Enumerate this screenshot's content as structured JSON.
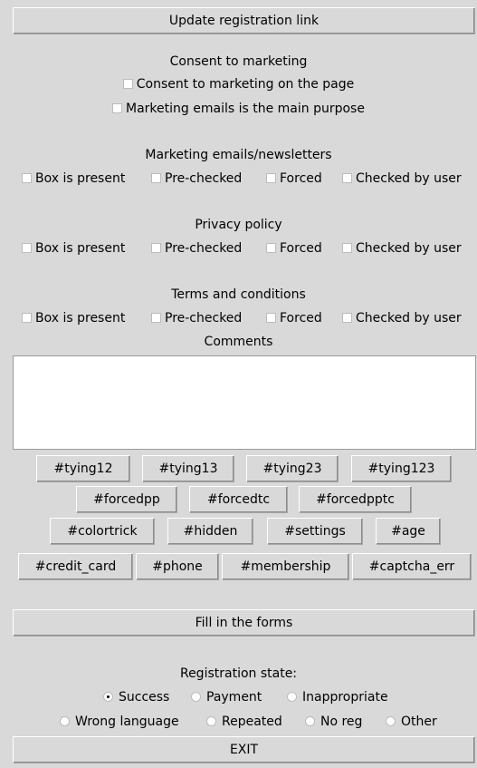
{
  "update_button": "Update registration link",
  "consent": {
    "title": "Consent to marketing",
    "opt1": "Consent to marketing on the page",
    "opt2": "Marketing emails is the main purpose"
  },
  "sections": {
    "marketing": "Marketing emails/newsletters",
    "privacy": "Privacy policy",
    "terms": "Terms and conditions"
  },
  "checkbox_options": {
    "present": "Box is present",
    "prechecked": "Pre-checked",
    "forced": "Forced",
    "checked_by_user": "Checked by user"
  },
  "comments_label": "Comments",
  "tags": {
    "t1": "#tying12",
    "t2": "#tying13",
    "t3": "#tying23",
    "t4": "#tying123",
    "t5": "#forcedpp",
    "t6": "#forcedtc",
    "t7": "#forcedpptc",
    "t8": "#colortrick",
    "t9": "#hidden",
    "t10": "#settings",
    "t11": "#age",
    "t12": "#credit_card",
    "t13": "#phone",
    "t14": "#membership",
    "t15": "#captcha_err"
  },
  "fill_button": "Fill in the forms",
  "registration": {
    "title": "Registration state:",
    "success": "Success",
    "payment": "Payment",
    "inappropriate": "Inappropriate",
    "wrong_language": "Wrong language",
    "repeated": "Repeated",
    "no_reg": "No reg",
    "other": "Other"
  },
  "exit_button": "EXIT"
}
